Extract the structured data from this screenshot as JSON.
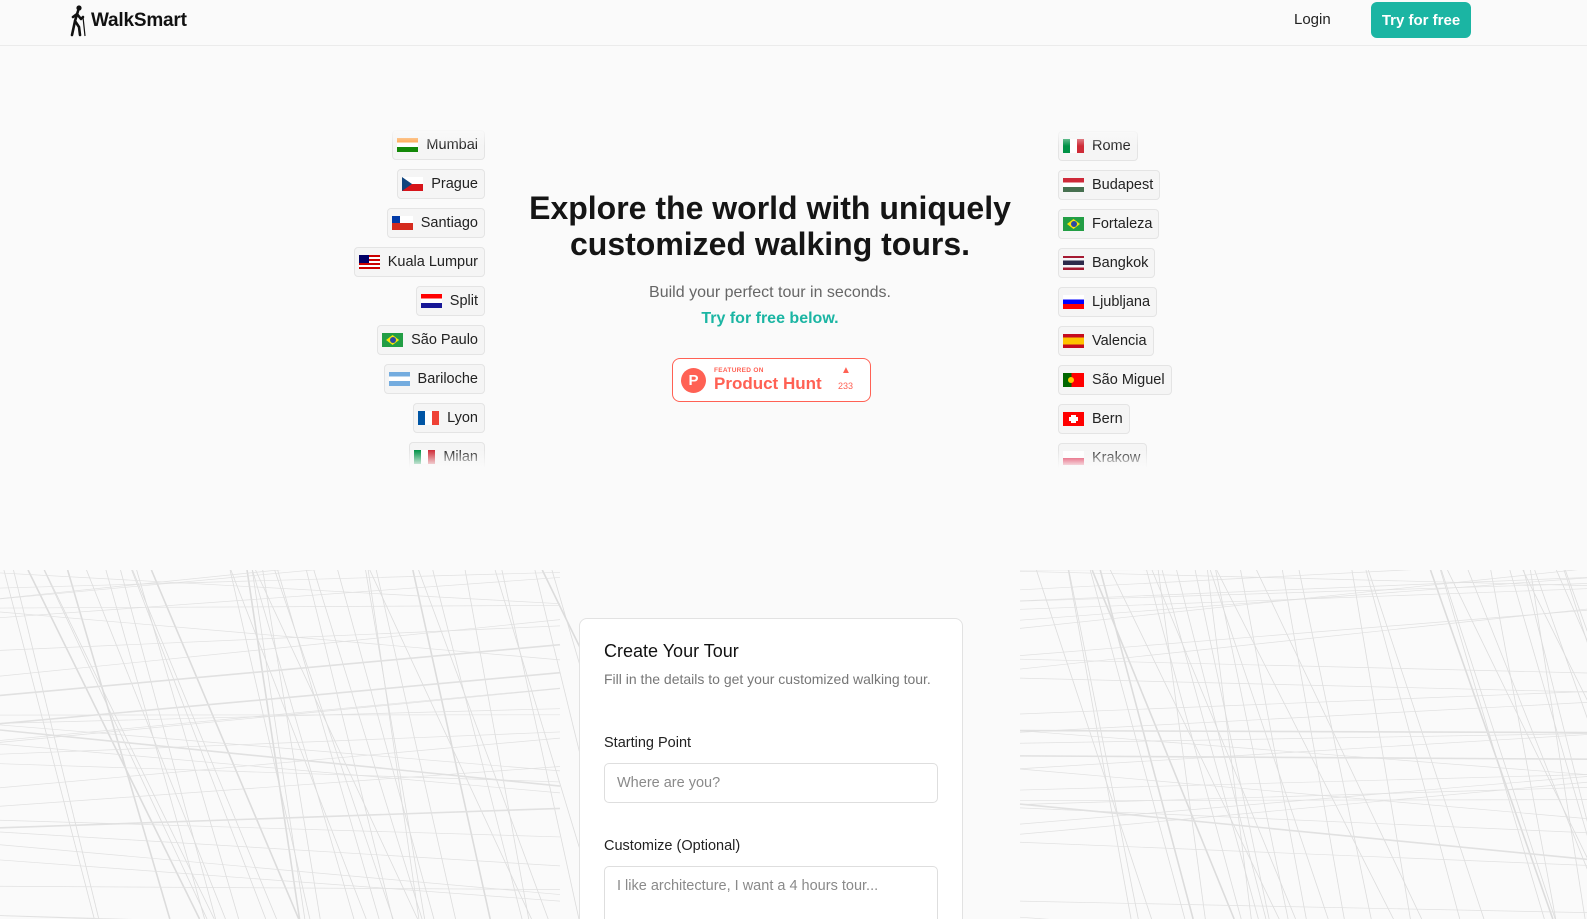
{
  "brand": {
    "name": "WalkSmart",
    "logo_icon": "walking-person-icon"
  },
  "nav": {
    "login_label": "Login",
    "cta_label": "Try for free"
  },
  "hero": {
    "headline": "Explore the world with uniquely customized walking tours.",
    "subtitle": "Build your perfect tour in seconds.",
    "cta": "Try for free below."
  },
  "product_hunt": {
    "featured": "FEATURED ON",
    "name": "Product Hunt",
    "votes": "233",
    "accent": "#ff6154"
  },
  "cities_left": [
    {
      "name": "Mumbai",
      "flag": "india-flag-icon"
    },
    {
      "name": "Prague",
      "flag": "czech-flag-icon"
    },
    {
      "name": "Santiago",
      "flag": "chile-flag-icon"
    },
    {
      "name": "Kuala Lumpur",
      "flag": "malaysia-flag-icon"
    },
    {
      "name": "Split",
      "flag": "croatia-flag-icon"
    },
    {
      "name": "São Paulo",
      "flag": "brazil-flag-icon"
    },
    {
      "name": "Bariloche",
      "flag": "argentina-flag-icon"
    },
    {
      "name": "Lyon",
      "flag": "france-flag-icon"
    },
    {
      "name": "Milan",
      "flag": "italy-flag-icon"
    }
  ],
  "cities_right": [
    {
      "name": "Rome",
      "flag": "italy-flag-icon"
    },
    {
      "name": "Budapest",
      "flag": "hungary-flag-icon"
    },
    {
      "name": "Fortaleza",
      "flag": "brazil-flag-icon"
    },
    {
      "name": "Bangkok",
      "flag": "thailand-flag-icon"
    },
    {
      "name": "Ljubljana",
      "flag": "slovenia-flag-icon"
    },
    {
      "name": "Valencia",
      "flag": "spain-flag-icon"
    },
    {
      "name": "São Miguel",
      "flag": "portugal-flag-icon"
    },
    {
      "name": "Bern",
      "flag": "switzerland-flag-icon"
    },
    {
      "name": "Krakow",
      "flag": "poland-flag-icon"
    }
  ],
  "form": {
    "title": "Create Your Tour",
    "description": "Fill in the details to get your customized walking tour.",
    "start_label": "Starting Point",
    "start_placeholder": "Where are you?",
    "custom_label": "Customize (Optional)",
    "custom_placeholder": "I like architecture, I want a 4 hours tour..."
  },
  "colors": {
    "accent": "#1bb5a3",
    "background": "#fafafa"
  }
}
